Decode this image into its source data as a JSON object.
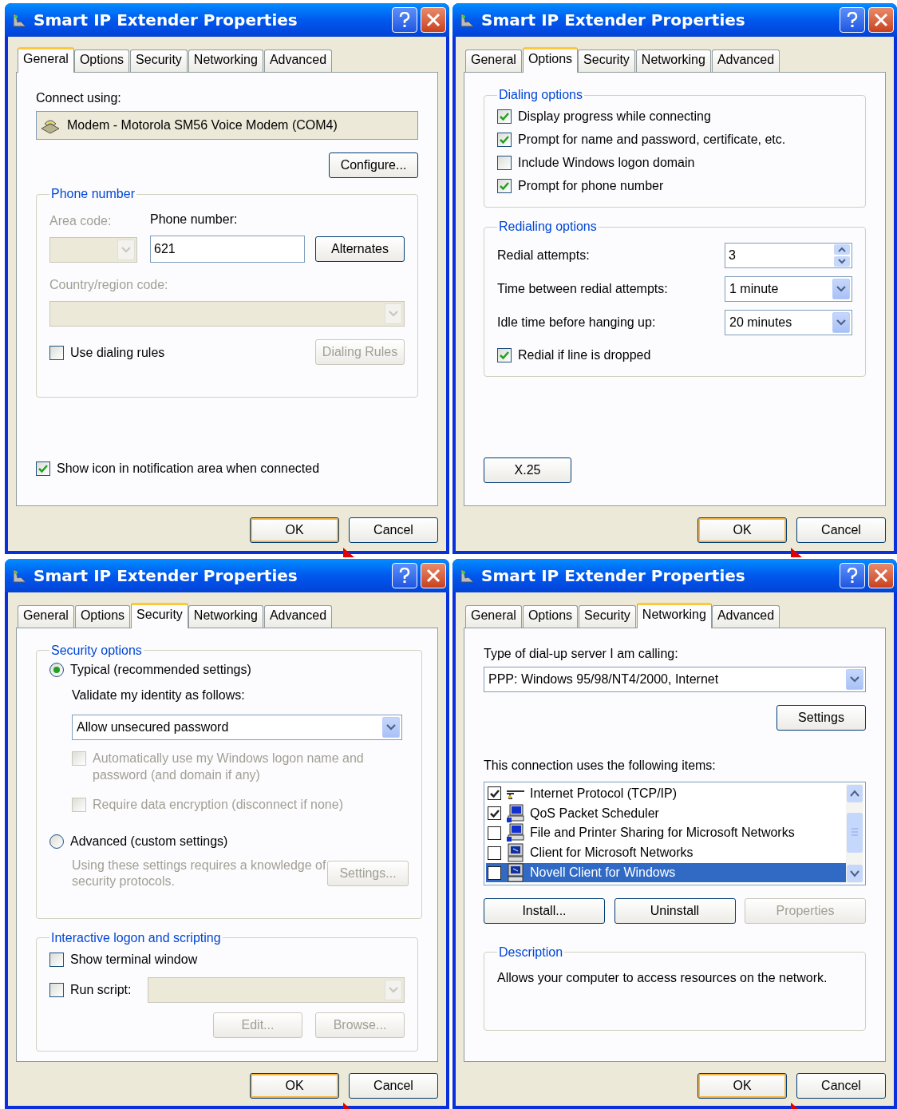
{
  "dialogs": [
    {
      "kind": "general",
      "title": "Smart IP Extender Properties",
      "tabs": [
        {
          "label": "General",
          "selected": true
        },
        {
          "label": "Options",
          "selected": false
        },
        {
          "label": "Security",
          "selected": false
        },
        {
          "label": "Networking",
          "selected": false
        },
        {
          "label": "Advanced",
          "selected": false
        }
      ],
      "connect_label": "Connect using:",
      "device": "Modem - Motorola SM56 Voice Modem (COM4)",
      "configure": {
        "label": "Configure...",
        "disabled": false
      },
      "phone_group": "Phone number",
      "area_label": "Area code:",
      "area_disabled": true,
      "phone_label": "Phone number:",
      "phone_value": "621",
      "alternates": {
        "label": "Alternates",
        "disabled": false
      },
      "country_label": "Country/region code:",
      "country_disabled": true,
      "use_rules": {
        "label": "Use dialing rules",
        "checked": false,
        "disabled": false
      },
      "dialing_rules": {
        "label": "Dialing Rules",
        "disabled": true
      },
      "show_icon": {
        "label": "Show icon in notification area when connected",
        "checked": true,
        "disabled": false
      },
      "buttons": [
        {
          "label": "OK",
          "default": true,
          "disabled": false
        },
        {
          "label": "Cancel",
          "default": false,
          "disabled": false
        }
      ]
    },
    {
      "kind": "options",
      "title": "Smart IP Extender Properties",
      "tabs": [
        {
          "label": "General",
          "selected": false
        },
        {
          "label": "Options",
          "selected": true
        },
        {
          "label": "Security",
          "selected": false
        },
        {
          "label": "Networking",
          "selected": false
        },
        {
          "label": "Advanced",
          "selected": false
        }
      ],
      "dialing_group": "Dialing options",
      "dialing_options": [
        {
          "label": "Display progress while connecting",
          "checked": true,
          "disabled": false
        },
        {
          "label": "Prompt for name and password, certificate, etc.",
          "checked": true,
          "disabled": false
        },
        {
          "label": "Include Windows logon domain",
          "checked": false,
          "disabled": false
        },
        {
          "label": "Prompt for phone number",
          "checked": true,
          "disabled": false
        }
      ],
      "redial_group": "Redialing options",
      "redial_rows": [
        {
          "kind": "spinner",
          "label": "Redial attempts:",
          "value": "3"
        },
        {
          "kind": "dropdown",
          "label": "Time between redial attempts:",
          "value": "1 minute"
        },
        {
          "kind": "dropdown",
          "label": "Idle time before hanging up:",
          "value": "20 minutes"
        }
      ],
      "redial_dropped": {
        "label": "Redial if line is dropped",
        "checked": true,
        "disabled": false
      },
      "x25": {
        "label": "X.25",
        "disabled": false
      },
      "buttons": [
        {
          "label": "OK",
          "default": true,
          "disabled": false
        },
        {
          "label": "Cancel",
          "default": false,
          "disabled": false
        }
      ]
    },
    {
      "kind": "security",
      "title": "Smart IP Extender Properties",
      "tabs": [
        {
          "label": "General",
          "selected": false
        },
        {
          "label": "Options",
          "selected": false
        },
        {
          "label": "Security",
          "selected": true
        },
        {
          "label": "Networking",
          "selected": false
        },
        {
          "label": "Advanced",
          "selected": false
        }
      ],
      "security_group": "Security options",
      "typical": {
        "label": "Typical (recommended settings)",
        "selected": true
      },
      "validate_label": "Validate my identity as follows:",
      "validate_value": "Allow unsecured password",
      "auto_logon": {
        "label": "Automatically use my Windows logon name and password (and domain if any)",
        "checked": false,
        "disabled": true
      },
      "encryption": {
        "label": "Require data encryption (disconnect if none)",
        "checked": false,
        "disabled": true
      },
      "advanced": {
        "label": "Advanced (custom settings)",
        "selected": false
      },
      "advanced_note": "Using these settings requires a knowledge of security protocols.",
      "advanced_disabled": true,
      "settings": {
        "label": "Settings...",
        "disabled": true
      },
      "logon_group": "Interactive logon and scripting",
      "terminal": {
        "label": "Show terminal window",
        "checked": false,
        "disabled": false
      },
      "run_script": {
        "label": "Run script:",
        "checked": false,
        "disabled": false
      },
      "script_disabled": true,
      "edit": {
        "label": "Edit...",
        "disabled": true
      },
      "browse": {
        "label": "Browse...",
        "disabled": true
      },
      "buttons": [
        {
          "label": "OK",
          "default": true,
          "disabled": false
        },
        {
          "label": "Cancel",
          "default": false,
          "disabled": false
        }
      ]
    },
    {
      "kind": "networking",
      "title": "Smart IP Extender Properties",
      "tabs": [
        {
          "label": "General",
          "selected": false
        },
        {
          "label": "Options",
          "selected": false
        },
        {
          "label": "Security",
          "selected": false
        },
        {
          "label": "Networking",
          "selected": true
        },
        {
          "label": "Advanced",
          "selected": false
        }
      ],
      "server_label": "Type of dial-up server I am calling:",
      "server_value": "PPP: Windows 95/98/NT4/2000, Internet",
      "settings": {
        "label": "Settings",
        "disabled": false
      },
      "items_label": "This connection uses the following items:",
      "items": [
        {
          "kind": "protocol",
          "label": "Internet Protocol (TCP/IP)",
          "checked": true,
          "selected": false
        },
        {
          "kind": "service",
          "label": "QoS Packet Scheduler",
          "checked": true,
          "selected": false
        },
        {
          "kind": "service",
          "label": "File and Printer Sharing for Microsoft Networks",
          "checked": false,
          "selected": false
        },
        {
          "kind": "client",
          "label": "Client for Microsoft Networks",
          "checked": false,
          "selected": false
        },
        {
          "kind": "client",
          "label": "Novell Client for Windows",
          "checked": false,
          "selected": true
        }
      ],
      "install": {
        "label": "Install...",
        "disabled": false
      },
      "uninstall": {
        "label": "Uninstall",
        "disabled": false
      },
      "properties": {
        "label": "Properties",
        "disabled": true
      },
      "description_group": "Description",
      "description": "Allows your computer to access resources on the network.",
      "buttons": [
        {
          "label": "OK",
          "default": true,
          "disabled": false
        },
        {
          "label": "Cancel",
          "default": false,
          "disabled": false
        }
      ]
    }
  ]
}
